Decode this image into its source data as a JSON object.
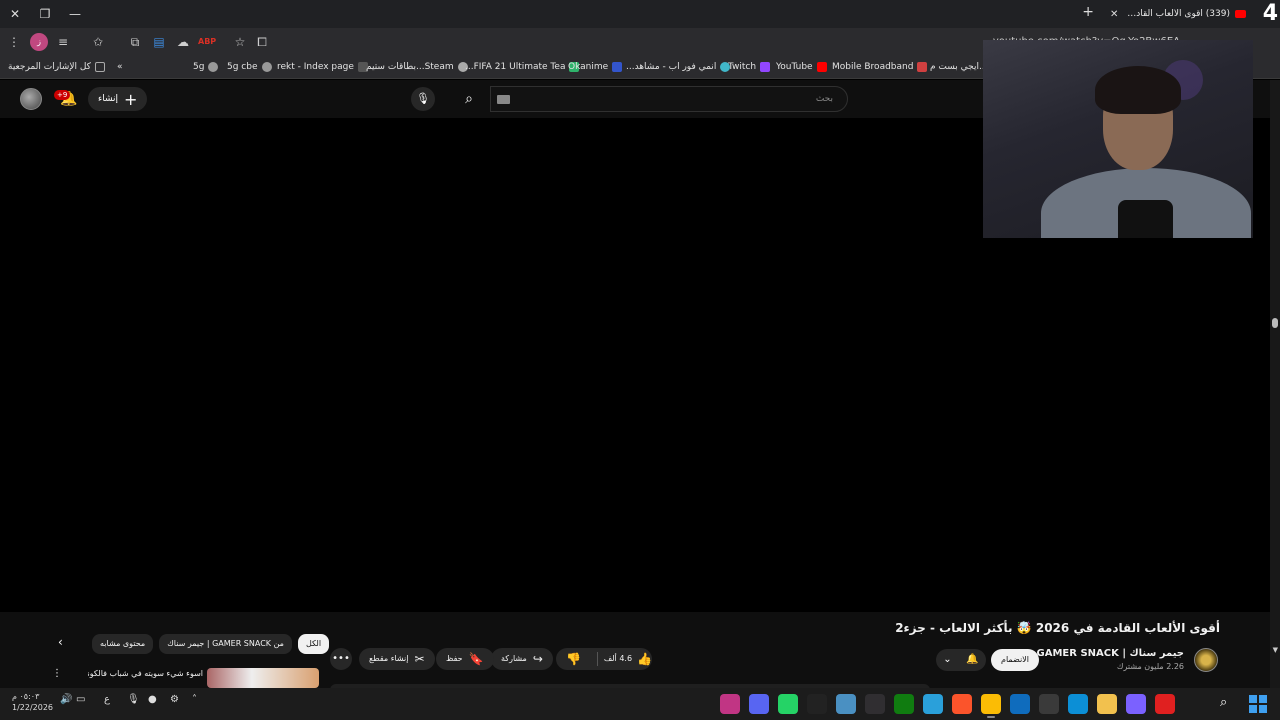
{
  "browser": {
    "tab_title": "(339) أقوى الألعاب القادمة في",
    "tab_count": "4",
    "url": "youtube.com/watch?v=Oq-Yo2Bw6EA",
    "bookmarks": [
      {
        "label": "كل الإشارات المرجعية",
        "color": "#888888"
      },
      {
        "label": "5g",
        "color": "#999999"
      },
      {
        "label": "5g cbe",
        "color": "#999999"
      },
      {
        "label": "rekt - Index page",
        "color": "#555555"
      },
      {
        "label": "Steam...بطاقات ستيم",
        "color": "#aaaaaa"
      },
      {
        "label": "FIFA 21 Ultimate Tea...",
        "color": "#2fb36b"
      },
      {
        "label": "Okanime",
        "color": "#3355cc"
      },
      {
        "label": "انمي فور اب - مشاهد...",
        "color": "#41b7c9"
      },
      {
        "label": "Twitch",
        "color": "#9146ff"
      },
      {
        "label": "YouTube",
        "color": "#ff0000"
      },
      {
        "label": "Mobile Broadband",
        "color": "#d04040"
      },
      {
        "label": "...ايجي بست م",
        "color": "#cc6600"
      }
    ]
  },
  "yt_header": {
    "search_placeholder": "بحث",
    "create_label": "إنشاء",
    "notif_badge": "+9"
  },
  "video": {
    "title": "أقوى الألعاب القادمة في 2026 🤯 بأكثر الالعاب - جزء2",
    "channel_name": "جيمر سناك | GAMER SNACK",
    "subscribers": "2.26 مليون مشترك",
    "join_label": "الانضمام",
    "likes": "4.6 ألف",
    "share_label": "مشاركة",
    "save_label": "حفظ",
    "clip_label": "إنشاء مقطع"
  },
  "related": {
    "chips": [
      "الكل",
      "من GAMER SNACK | جيمر سناك",
      "محتوى مشابه"
    ],
    "active_chip": 0,
    "rec_title": "اسوء شيء سويته في شباب فالكونز .."
  },
  "taskbar": {
    "time": "٠٥:٠٣ م",
    "date": "1/22/2026",
    "lang": "ع",
    "apps": [
      {
        "name": "instagram-app",
        "color": "#c13584"
      },
      {
        "name": "discord-app",
        "color": "#5865f2"
      },
      {
        "name": "whatsapp-app",
        "color": "#25d366"
      },
      {
        "name": "capcut-app",
        "color": "#222222"
      },
      {
        "name": "photos-app",
        "color": "#4a90c2"
      },
      {
        "name": "obs-app",
        "color": "#302e31"
      },
      {
        "name": "xbox-app",
        "color": "#107c10"
      },
      {
        "name": "telegram-app",
        "color": "#2aa0da"
      },
      {
        "name": "brave-app",
        "color": "#fb542b"
      },
      {
        "name": "chrome-app",
        "color": "#fbbc05"
      },
      {
        "name": "outlook-app",
        "color": "#0f6cbd"
      },
      {
        "name": "store-app",
        "color": "#3a3a3a"
      },
      {
        "name": "edge-app",
        "color": "#0c8fd6"
      },
      {
        "name": "explorer-app",
        "color": "#f2c14e"
      },
      {
        "name": "copilot-app",
        "color": "#7b61ff"
      },
      {
        "name": "adobe-app",
        "color": "#e02020"
      }
    ]
  }
}
